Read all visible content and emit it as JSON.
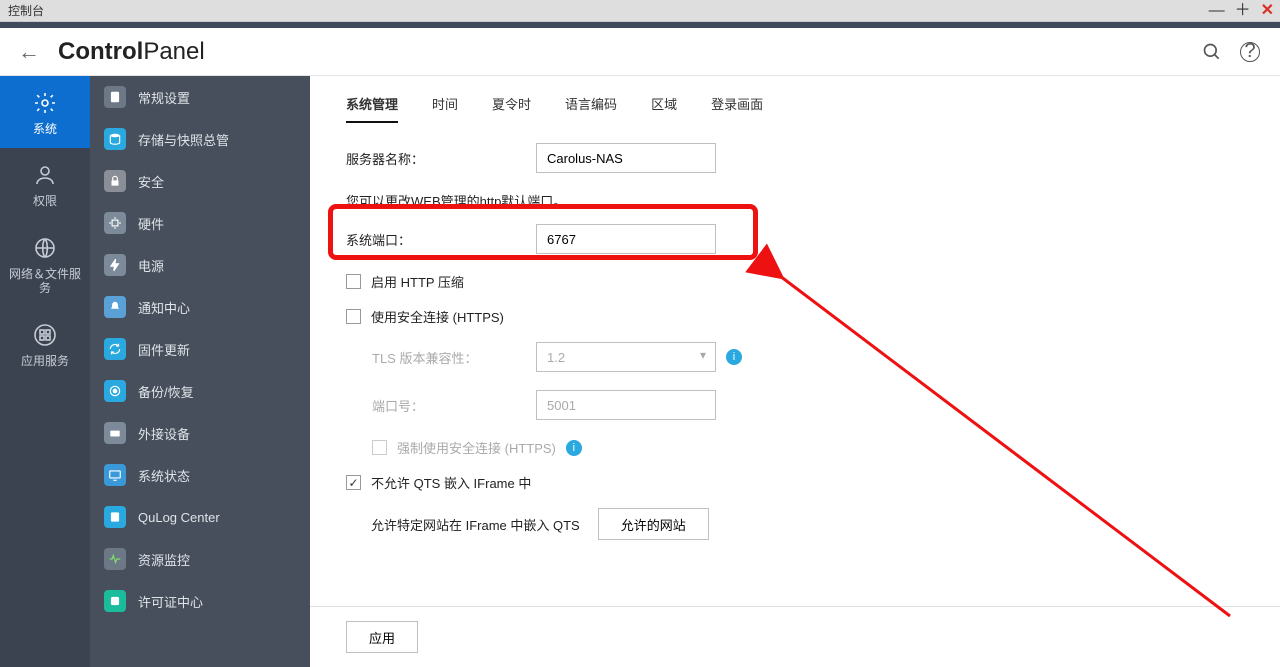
{
  "window": {
    "title": "控制台"
  },
  "header": {
    "brand_bold": "Control",
    "brand_light": "Panel"
  },
  "rail": [
    {
      "icon": "gear",
      "label": "系统",
      "active": true
    },
    {
      "icon": "user",
      "label": "权限",
      "active": false
    },
    {
      "icon": "globe",
      "label": "网络＆文件服务",
      "active": false
    },
    {
      "icon": "grid",
      "label": "应用服务",
      "active": false
    }
  ],
  "sidebar": [
    {
      "icon": "doc",
      "label": "常规设置",
      "color": "#6d7886"
    },
    {
      "icon": "disk",
      "label": "存储与快照总管",
      "color": "#2aa9e0"
    },
    {
      "icon": "lock",
      "label": "安全",
      "color": "#8a8f97"
    },
    {
      "icon": "chip",
      "label": "硬件",
      "color": "#7c8a99"
    },
    {
      "icon": "power",
      "label": "电源",
      "color": "#7c8a99"
    },
    {
      "icon": "bell",
      "label": "通知中心",
      "color": "#5aa1d8"
    },
    {
      "icon": "refresh",
      "label": "固件更新",
      "color": "#2aa9e0"
    },
    {
      "icon": "restore",
      "label": "备份/恢复",
      "color": "#2aa9e0"
    },
    {
      "icon": "usb",
      "label": "外接设备",
      "color": "#7c8a99"
    },
    {
      "icon": "monitor",
      "label": "系统状态",
      "color": "#3a99d8"
    },
    {
      "icon": "log",
      "label": "QuLog Center",
      "color": "#2aa9e0"
    },
    {
      "icon": "pulse",
      "label": "资源监控",
      "color": "#6d7886"
    },
    {
      "icon": "license",
      "label": "许可证中心",
      "color": "#1abc9c"
    }
  ],
  "tabs": [
    "系统管理",
    "时间",
    "夏令时",
    "语言编码",
    "区域",
    "登录画面"
  ],
  "active_tab": 0,
  "form": {
    "server_name_label": "服务器名称：",
    "server_name_value": "Carolus-NAS",
    "port_hint": "您可以更改WEB管理的http默认端口。",
    "sys_port_label": "系统端口：",
    "sys_port_value": "6767",
    "http_compress": "启用 HTTP 压缩",
    "https_enable": "使用安全连接 (HTTPS)",
    "tls_label": "TLS 版本兼容性：",
    "tls_value": "1.2",
    "https_port_label": "端口号：",
    "https_port_value": "5001",
    "https_force": "强制使用安全连接 (HTTPS)",
    "iframe_deny": "不允许 QTS 嵌入 IFrame 中",
    "iframe_allow_sites_label": "允许特定网站在 IFrame 中嵌入 QTS",
    "iframe_allow_sites_button": "允许的网站",
    "apply": "应用"
  }
}
